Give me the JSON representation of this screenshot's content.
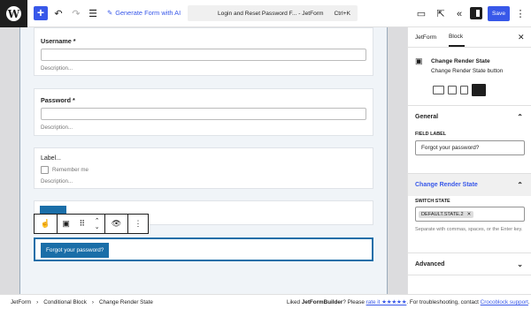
{
  "topbar": {
    "generate_label": "Generate Form with AI",
    "doc_title": "Login and Reset Password F... - JetForm",
    "shortcut": "Ctrl+K",
    "save_label": "Save"
  },
  "form": {
    "username_label": "Username *",
    "username_desc": "Description...",
    "password_label": "Password *",
    "password_desc": "Description...",
    "checkbox_field_label": "Label...",
    "remember_label": "Remember me",
    "checkbox_desc": "Description...",
    "forgot_button": "Forgot your password?"
  },
  "statusbar": {
    "breadcrumb": [
      "JetForm",
      "Conditional Block",
      "Change Render State"
    ],
    "liked_prefix": "Liked ",
    "brand": "JetFormBuilder",
    "please": "? Please ",
    "rate": "rate it ★★★★★",
    "trouble": ". For troubleshooting, contact ",
    "support": "Crocoblock support",
    "end": "."
  },
  "sidebar": {
    "tabs": [
      "JetForm",
      "Block"
    ],
    "active_tab": "Block",
    "block_title": "Change Render State",
    "block_desc": "Change Render State button",
    "general_label": "General",
    "field_label_caption": "FIELD LABEL",
    "field_label_value": "Forgot your password?",
    "crs_label": "Change Render State",
    "switch_caption": "SWITCH STATE",
    "switch_token": "DEFAULT.STATE.2",
    "help": "Separate with commas, spaces, or the Enter key.",
    "advanced_label": "Advanced"
  },
  "colors": {
    "accent": "#3858e9",
    "button": "#1a6ea8"
  }
}
